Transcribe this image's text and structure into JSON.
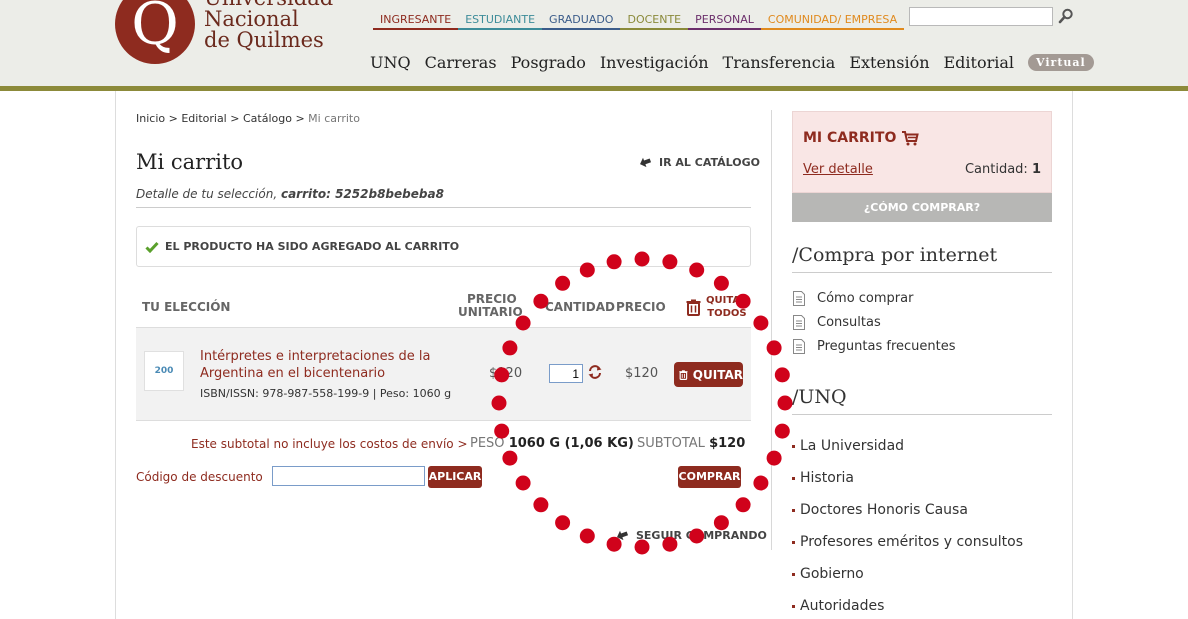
{
  "header": {
    "logo_letter": "Q",
    "logo_lines": [
      "Universidad",
      "Nacional",
      "de Quilmes"
    ],
    "top_nav": [
      {
        "label": "INGRESANTE",
        "color": "#8e2b1f"
      },
      {
        "label": "ESTUDIANTE",
        "color": "#3d8c99"
      },
      {
        "label": "GRADUADO",
        "color": "#3b5c8a"
      },
      {
        "label": "DOCENTE",
        "color": "#8a8a3a"
      },
      {
        "label": "PERSONAL",
        "color": "#6b2f6b"
      },
      {
        "label": "COMUNIDAD/ EMPRESA",
        "color": "#e08a1e"
      }
    ],
    "search_placeholder": "",
    "main_nav": [
      "UNQ",
      "Carreras",
      "Posgrado",
      "Investigación",
      "Transferencia",
      "Extensión",
      "Editorial"
    ],
    "virtual_label": "Virtual"
  },
  "breadcrumb": {
    "items": [
      "Inicio",
      "Editorial",
      "Catálogo"
    ],
    "separator": ">",
    "current": "Mi carrito"
  },
  "page": {
    "title": "Mi carrito",
    "back_catalog": "IR AL CATÁLOGO",
    "subtitle_prefix": "Detalle de tu selección,",
    "subtitle_cart": "carrito: 5252b8bebeba8",
    "notice": "EL PRODUCTO HA SIDO AGREGADO AL CARRITO"
  },
  "table": {
    "headers": {
      "choice": "TU ELECCIÓN",
      "unit_price_1": "PRECIO",
      "unit_price_2": "UNITARIO",
      "quantity": "CANTIDAD",
      "price": "PRECIO",
      "remove_all_1": "QUITAR",
      "remove_all_2": "TODOS"
    },
    "row": {
      "thumb_label": "200",
      "title": "Intérpretes e interpretaciones de la Argentina en el bicentenario",
      "meta": "ISBN/ISSN: 978-987-558-199-9 | Peso: 1060 g",
      "unit_price": "$120",
      "quantity": "1",
      "price": "$120",
      "remove_label": "QUITAR"
    }
  },
  "summary": {
    "shipping_note": "Este subtotal no incluye los costos de envío >",
    "weight_label": "PESO",
    "weight_value": "1060 G (1,06 KG)",
    "subtotal_label": "SUBTOTAL",
    "subtotal_value": "$120",
    "discount_label": "Código de descuento",
    "discount_value": "",
    "apply_label": "APLICAR",
    "buy_label": "COMPRAR",
    "keep_shopping": "SEGUIR COMPRANDO"
  },
  "sidebar": {
    "cart_title": "MI CARRITO",
    "cart_detail": "Ver detalle",
    "cart_qty_label": "Cantidad:",
    "cart_qty_value": "1",
    "how_to_buy": "¿CÓMO COMPRAR?",
    "online_heading": "/Compra por internet",
    "online_links": [
      "Cómo comprar",
      "Consultas",
      "Preguntas frecuentes"
    ],
    "unq_heading": "/UNQ",
    "unq_links": [
      "La Universidad",
      "Historia",
      "Doctores Honoris Causa",
      "Profesores eméritos y consultos",
      "Gobierno",
      "Autoridades"
    ]
  },
  "colors": {
    "brand": "#8e2b1f",
    "header_bg": "#ecede8",
    "header_line": "#8c8a3a",
    "overlay_dots": "#d0021b"
  }
}
